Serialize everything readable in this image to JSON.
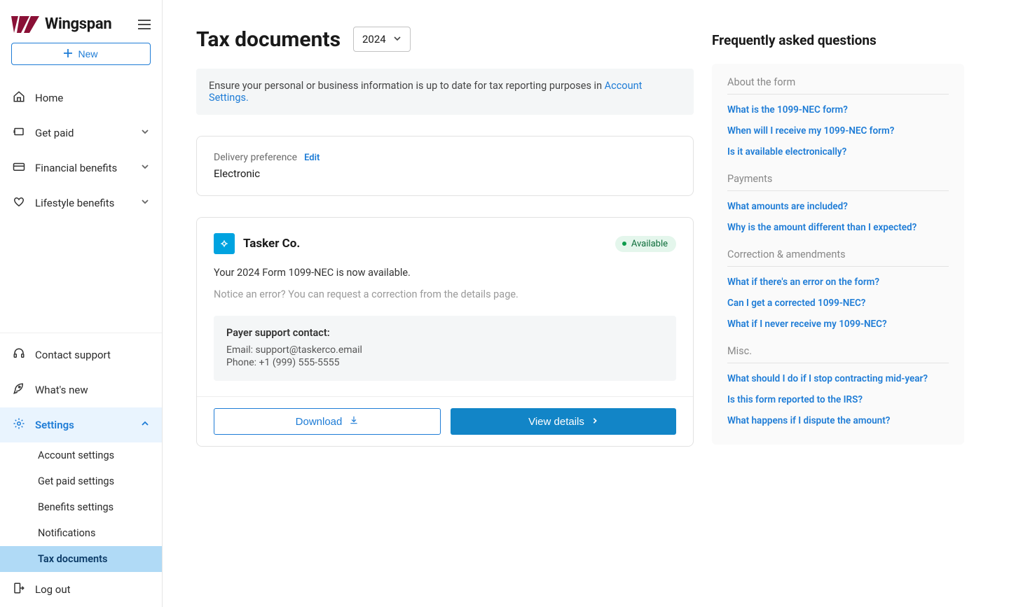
{
  "brand": {
    "name": "Wingspan"
  },
  "buttons": {
    "new": "New"
  },
  "nav": {
    "items": [
      {
        "label": "Home",
        "icon": "home"
      },
      {
        "label": "Get paid",
        "icon": "money-in",
        "expandable": true
      },
      {
        "label": "Financial benefits",
        "icon": "card",
        "expandable": true
      },
      {
        "label": "Lifestyle benefits",
        "icon": "heart",
        "expandable": true
      }
    ],
    "bottom": [
      {
        "label": "Contact support",
        "icon": "headset"
      },
      {
        "label": "What's new",
        "icon": "rocket"
      },
      {
        "label": "Settings",
        "icon": "gear",
        "expanded": true,
        "active": true
      }
    ],
    "settings_sub": [
      {
        "label": "Account settings"
      },
      {
        "label": "Get paid settings"
      },
      {
        "label": "Benefits settings"
      },
      {
        "label": "Notifications"
      },
      {
        "label": "Tax documents",
        "active": true
      }
    ],
    "logout": {
      "label": "Log out",
      "icon": "logout"
    }
  },
  "page": {
    "title": "Tax documents",
    "year": "2024",
    "banner_text": "Ensure your personal or business information is up to date for tax reporting purposes in ",
    "banner_link": "Account Settings."
  },
  "delivery": {
    "label": "Delivery preference",
    "edit": "Edit",
    "value": "Electronic"
  },
  "doc": {
    "company": "Tasker Co.",
    "status": "Available",
    "message": "Your 2024 Form 1099-NEC is now available.",
    "note": "Notice an error? You can request a correction from the details page.",
    "support_title": "Payer support contact:",
    "support_email_label": "Email: ",
    "support_email": "support@taskerco.email",
    "support_phone_label": "Phone: ",
    "support_phone": "+1 (999) 555-5555",
    "download": "Download",
    "view_details": "View details"
  },
  "faq": {
    "title": "Frequently asked questions",
    "groups": [
      {
        "heading": "About the form",
        "links": [
          "What is the 1099-NEC form?",
          "When will I receive my 1099-NEC form?",
          "Is it available electronically?"
        ]
      },
      {
        "heading": "Payments",
        "links": [
          "What amounts are included?",
          "Why is the amount different than I expected?"
        ]
      },
      {
        "heading": "Correction & amendments",
        "links": [
          "What if there's an error on the form?",
          "Can I get a corrected 1099-NEC?",
          "What if I never receive my 1099-NEC?"
        ]
      },
      {
        "heading": "Misc.",
        "links": [
          "What should I do if I stop contracting mid-year?",
          "Is this form reported to the IRS?",
          "What happens if I dispute the amount?"
        ]
      }
    ]
  }
}
